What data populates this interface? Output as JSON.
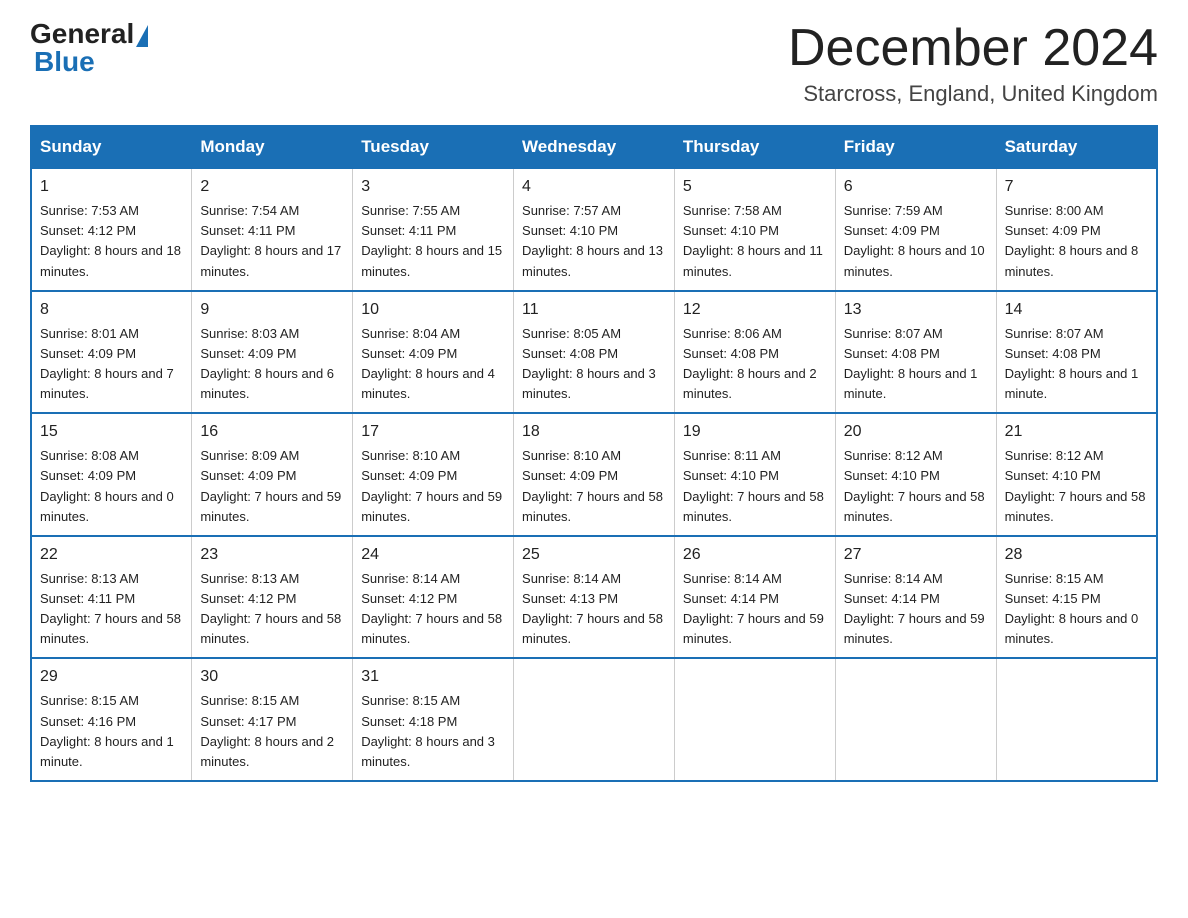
{
  "logo": {
    "general": "General",
    "blue": "Blue"
  },
  "title": {
    "month": "December 2024",
    "location": "Starcross, England, United Kingdom"
  },
  "weekdays": [
    "Sunday",
    "Monday",
    "Tuesday",
    "Wednesday",
    "Thursday",
    "Friday",
    "Saturday"
  ],
  "weeks": [
    [
      {
        "day": "1",
        "sunrise": "7:53 AM",
        "sunset": "4:12 PM",
        "daylight": "8 hours and 18 minutes."
      },
      {
        "day": "2",
        "sunrise": "7:54 AM",
        "sunset": "4:11 PM",
        "daylight": "8 hours and 17 minutes."
      },
      {
        "day": "3",
        "sunrise": "7:55 AM",
        "sunset": "4:11 PM",
        "daylight": "8 hours and 15 minutes."
      },
      {
        "day": "4",
        "sunrise": "7:57 AM",
        "sunset": "4:10 PM",
        "daylight": "8 hours and 13 minutes."
      },
      {
        "day": "5",
        "sunrise": "7:58 AM",
        "sunset": "4:10 PM",
        "daylight": "8 hours and 11 minutes."
      },
      {
        "day": "6",
        "sunrise": "7:59 AM",
        "sunset": "4:09 PM",
        "daylight": "8 hours and 10 minutes."
      },
      {
        "day": "7",
        "sunrise": "8:00 AM",
        "sunset": "4:09 PM",
        "daylight": "8 hours and 8 minutes."
      }
    ],
    [
      {
        "day": "8",
        "sunrise": "8:01 AM",
        "sunset": "4:09 PM",
        "daylight": "8 hours and 7 minutes."
      },
      {
        "day": "9",
        "sunrise": "8:03 AM",
        "sunset": "4:09 PM",
        "daylight": "8 hours and 6 minutes."
      },
      {
        "day": "10",
        "sunrise": "8:04 AM",
        "sunset": "4:09 PM",
        "daylight": "8 hours and 4 minutes."
      },
      {
        "day": "11",
        "sunrise": "8:05 AM",
        "sunset": "4:08 PM",
        "daylight": "8 hours and 3 minutes."
      },
      {
        "day": "12",
        "sunrise": "8:06 AM",
        "sunset": "4:08 PM",
        "daylight": "8 hours and 2 minutes."
      },
      {
        "day": "13",
        "sunrise": "8:07 AM",
        "sunset": "4:08 PM",
        "daylight": "8 hours and 1 minute."
      },
      {
        "day": "14",
        "sunrise": "8:07 AM",
        "sunset": "4:08 PM",
        "daylight": "8 hours and 1 minute."
      }
    ],
    [
      {
        "day": "15",
        "sunrise": "8:08 AM",
        "sunset": "4:09 PM",
        "daylight": "8 hours and 0 minutes."
      },
      {
        "day": "16",
        "sunrise": "8:09 AM",
        "sunset": "4:09 PM",
        "daylight": "7 hours and 59 minutes."
      },
      {
        "day": "17",
        "sunrise": "8:10 AM",
        "sunset": "4:09 PM",
        "daylight": "7 hours and 59 minutes."
      },
      {
        "day": "18",
        "sunrise": "8:10 AM",
        "sunset": "4:09 PM",
        "daylight": "7 hours and 58 minutes."
      },
      {
        "day": "19",
        "sunrise": "8:11 AM",
        "sunset": "4:10 PM",
        "daylight": "7 hours and 58 minutes."
      },
      {
        "day": "20",
        "sunrise": "8:12 AM",
        "sunset": "4:10 PM",
        "daylight": "7 hours and 58 minutes."
      },
      {
        "day": "21",
        "sunrise": "8:12 AM",
        "sunset": "4:10 PM",
        "daylight": "7 hours and 58 minutes."
      }
    ],
    [
      {
        "day": "22",
        "sunrise": "8:13 AM",
        "sunset": "4:11 PM",
        "daylight": "7 hours and 58 minutes."
      },
      {
        "day": "23",
        "sunrise": "8:13 AM",
        "sunset": "4:12 PM",
        "daylight": "7 hours and 58 minutes."
      },
      {
        "day": "24",
        "sunrise": "8:14 AM",
        "sunset": "4:12 PM",
        "daylight": "7 hours and 58 minutes."
      },
      {
        "day": "25",
        "sunrise": "8:14 AM",
        "sunset": "4:13 PM",
        "daylight": "7 hours and 58 minutes."
      },
      {
        "day": "26",
        "sunrise": "8:14 AM",
        "sunset": "4:14 PM",
        "daylight": "7 hours and 59 minutes."
      },
      {
        "day": "27",
        "sunrise": "8:14 AM",
        "sunset": "4:14 PM",
        "daylight": "7 hours and 59 minutes."
      },
      {
        "day": "28",
        "sunrise": "8:15 AM",
        "sunset": "4:15 PM",
        "daylight": "8 hours and 0 minutes."
      }
    ],
    [
      {
        "day": "29",
        "sunrise": "8:15 AM",
        "sunset": "4:16 PM",
        "daylight": "8 hours and 1 minute."
      },
      {
        "day": "30",
        "sunrise": "8:15 AM",
        "sunset": "4:17 PM",
        "daylight": "8 hours and 2 minutes."
      },
      {
        "day": "31",
        "sunrise": "8:15 AM",
        "sunset": "4:18 PM",
        "daylight": "8 hours and 3 minutes."
      },
      null,
      null,
      null,
      null
    ]
  ],
  "labels": {
    "sunrise": "Sunrise:",
    "sunset": "Sunset:",
    "daylight": "Daylight:"
  }
}
